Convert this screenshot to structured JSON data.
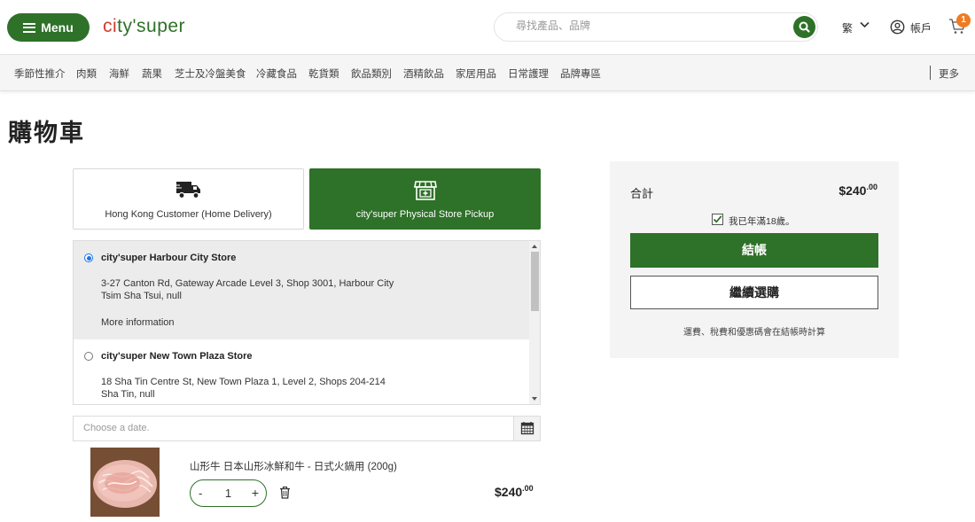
{
  "header": {
    "menu_label": "Menu",
    "logo_text_part1": "c",
    "logo_text_part2": "i",
    "logo_text_part3": "ty'super",
    "search_placeholder": "尋找產品、品牌",
    "language": "繁",
    "account_label": "帳戶",
    "cart_count": "1",
    "accent_color": "#2e7128",
    "badge_color": "#ef7b22"
  },
  "category_nav": {
    "items": [
      "季節性推介",
      "肉類",
      "海鮮",
      "蔬果",
      "芝士及冷盤美食",
      "冷藏食品",
      "乾貨類",
      "飲品類別",
      "酒精飲品",
      "家居用品",
      "日常護理",
      "品牌專區"
    ],
    "more_label": "更多"
  },
  "page": {
    "title": "購物車"
  },
  "delivery_tabs": [
    {
      "label": "Hong Kong Customer (Home Delivery)",
      "icon": "truck-icon",
      "active": false
    },
    {
      "label": "city'super Physical Store Pickup",
      "icon": "store-icon",
      "active": true
    }
  ],
  "stores": [
    {
      "name": "city'super Harbour City Store",
      "address_line1": "3-27 Canton Rd, Gateway Arcade Level 3, Shop 3001, Harbour City",
      "address_line2": "Tsim Sha Tsui, null",
      "more_label": "More information",
      "selected": true
    },
    {
      "name": "city'super New Town Plaza Store",
      "address_line1": "18 Sha Tin Centre St, New Town Plaza 1, Level 2, Shops 204-214",
      "address_line2": "Sha Tin, null",
      "selected": false
    }
  ],
  "date_picker": {
    "placeholder": "Choose a date."
  },
  "cart_items": [
    {
      "name": "山形牛 日本山形冰鮮和牛 - 日式火鍋用 (200g)",
      "quantity": "1",
      "minus_label": "-",
      "plus_label": "+",
      "price_main": "$240",
      "price_cents": ".00"
    }
  ],
  "summary": {
    "total_label": "合計",
    "total_main": "$240",
    "total_cents": ".00",
    "age_confirm_label": "我已年滿18歲。",
    "age_confirmed": true,
    "checkout_label": "結帳",
    "continue_label": "繼續選購",
    "note": "運費、稅費和優惠碼會在結帳時計算"
  }
}
